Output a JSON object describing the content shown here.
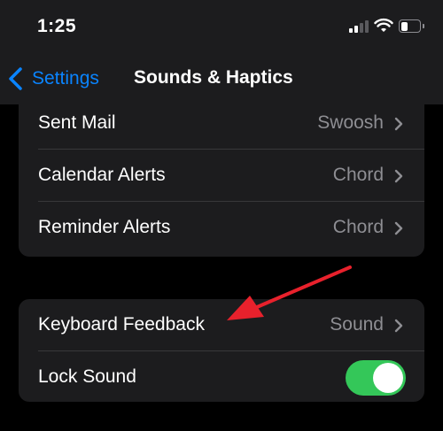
{
  "status": {
    "time": "1:25"
  },
  "nav": {
    "back_label": "Settings",
    "title": "Sounds & Haptics"
  },
  "alerts": [
    {
      "label": "Sent Mail",
      "value": "Swoosh"
    },
    {
      "label": "Calendar Alerts",
      "value": "Chord"
    },
    {
      "label": "Reminder Alerts",
      "value": "Chord"
    }
  ],
  "feedback": {
    "keyboard": {
      "label": "Keyboard Feedback",
      "value": "Sound"
    },
    "lock": {
      "label": "Lock Sound",
      "on": true
    }
  },
  "colors": {
    "accent": "#0a84ff",
    "toggle_on": "#34c759",
    "annotation": "#e8212c"
  },
  "icons": [
    "back-chevron-icon",
    "chevron-right-icon",
    "wifi-icon",
    "battery-icon",
    "cellular-signal-icon",
    "annotation-arrow"
  ]
}
